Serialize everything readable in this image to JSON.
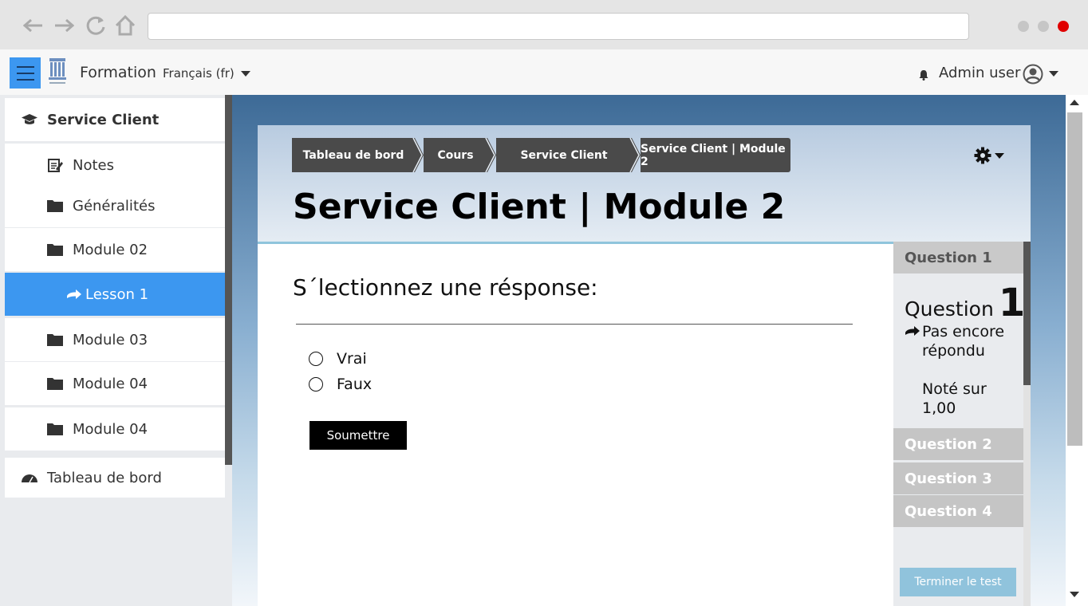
{
  "browser": {
    "back_icon": "arrow-left-icon",
    "forward_icon": "arrow-right-icon",
    "reload_icon": "reload-icon",
    "home_icon": "home-icon",
    "url": "",
    "window_dots": [
      "#c6c6c6",
      "#c6c6c6",
      "#e00000"
    ]
  },
  "navbar": {
    "brand": "Formation",
    "language": "Français (fr)",
    "user_name": "Admin user",
    "accent": "#3c97f0"
  },
  "sidebar": {
    "course": "Service Client",
    "items": [
      {
        "label": "Notes",
        "icon": "notes-icon"
      },
      {
        "label": "Généralités",
        "icon": "folder-icon"
      },
      {
        "label": "Module 02",
        "icon": "folder-icon"
      },
      {
        "label": "Lesson 1",
        "icon": "arrow-right-icon",
        "active": true
      },
      {
        "label": "Module 03",
        "icon": "folder-icon"
      },
      {
        "label": "Module 04",
        "icon": "folder-icon"
      },
      {
        "label": "Module 04",
        "icon": "folder-icon"
      }
    ],
    "dashboard": "Tableau de bord"
  },
  "breadcrumb": [
    "Tableau de bord",
    "Cours",
    "Service Client",
    "Service Client | Module 2"
  ],
  "page": {
    "title": "Service Client | Module 2"
  },
  "question": {
    "prompt": "S´lectionnez une résponse:",
    "options": [
      "Vrai",
      "Faux"
    ],
    "submit": "Soumettre"
  },
  "quiz_nav": {
    "current_tab": "Question 1",
    "big_label": "Question",
    "big_number": "1",
    "status": "Pas encore répondu",
    "grade": "Noté sur 1,00",
    "tabs": [
      "Question 2",
      "Question 3",
      "Question 4"
    ],
    "finish": "Terminer le test"
  }
}
